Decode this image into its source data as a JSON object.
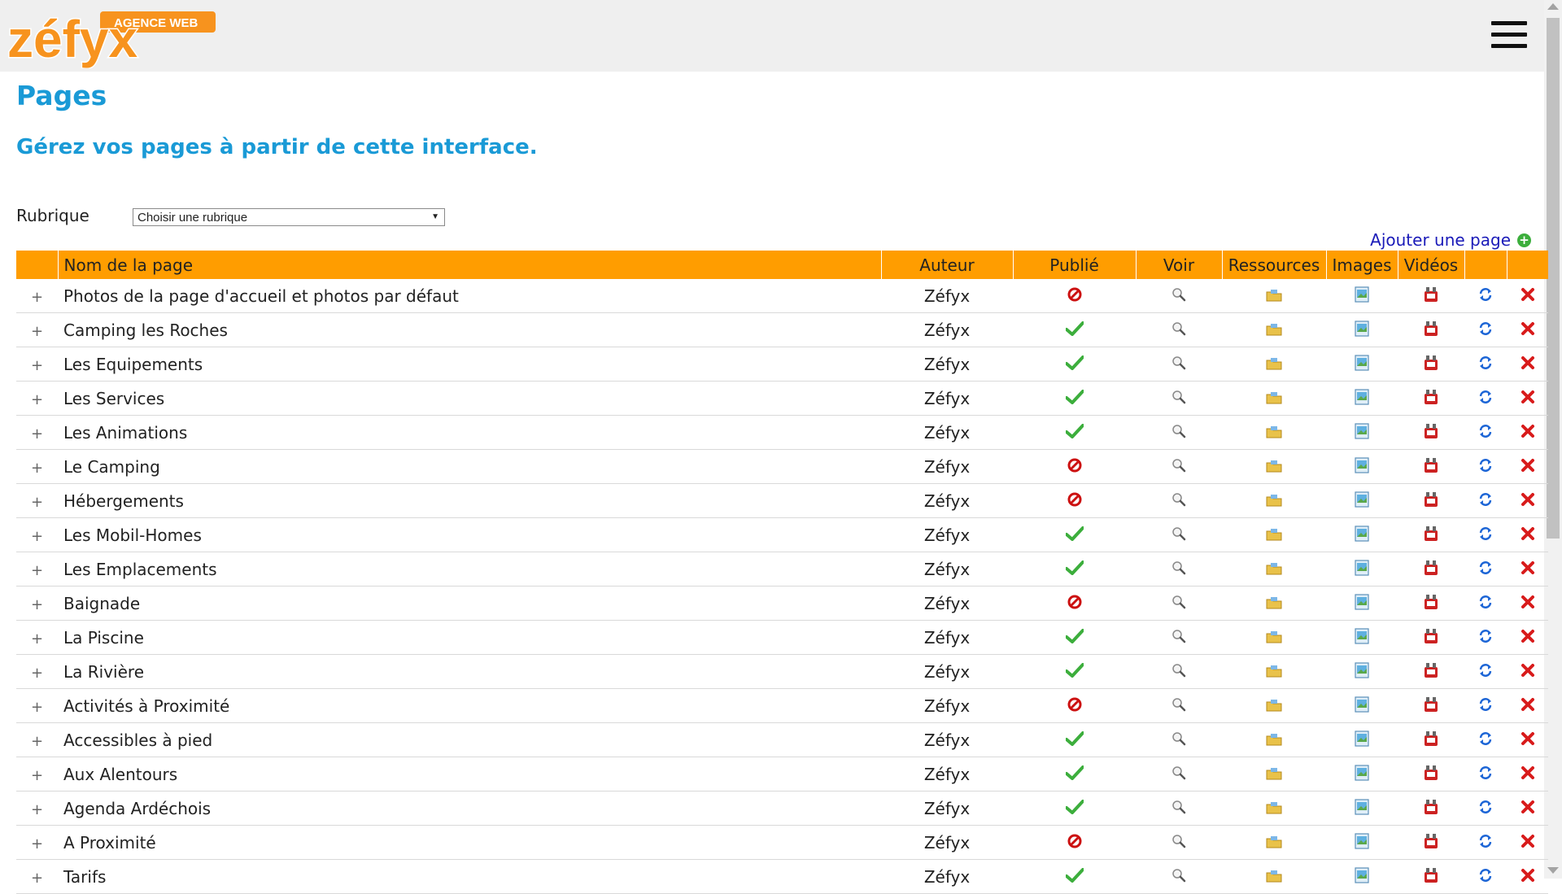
{
  "header": {
    "logo_text": "zéfyx",
    "logo_tagline": "AGENCE WEB",
    "menu_icon": "hamburger-menu-icon"
  },
  "page": {
    "title": "Pages",
    "subtitle": "Gérez vos pages à partir de cette interface."
  },
  "filter": {
    "label": "Rubrique",
    "select_value": "Choisir une rubrique"
  },
  "actions": {
    "add_page_label": "Ajouter une page",
    "add_icon": "plus-circle-icon"
  },
  "table": {
    "columns": [
      "",
      "Nom de la page",
      "Auteur",
      "Publié",
      "Voir",
      "Ressources",
      "Images",
      "Vidéos",
      "",
      ""
    ],
    "expand_symbol": "+",
    "rows": [
      {
        "name": "Photos de la page d'accueil et photos par défaut",
        "author": "Zéfyx",
        "published": false
      },
      {
        "name": "Camping les Roches",
        "author": "Zéfyx",
        "published": true
      },
      {
        "name": "Les Equipements",
        "author": "Zéfyx",
        "published": true
      },
      {
        "name": "Les Services",
        "author": "Zéfyx",
        "published": true
      },
      {
        "name": "Les Animations",
        "author": "Zéfyx",
        "published": true
      },
      {
        "name": "Le Camping",
        "author": "Zéfyx",
        "published": false
      },
      {
        "name": "Hébergements",
        "author": "Zéfyx",
        "published": false
      },
      {
        "name": "Les Mobil-Homes",
        "author": "Zéfyx",
        "published": true
      },
      {
        "name": "Les Emplacements",
        "author": "Zéfyx",
        "published": true
      },
      {
        "name": "Baignade",
        "author": "Zéfyx",
        "published": false
      },
      {
        "name": "La Piscine",
        "author": "Zéfyx",
        "published": true
      },
      {
        "name": "La Rivière",
        "author": "Zéfyx",
        "published": true
      },
      {
        "name": "Activités à Proximité",
        "author": "Zéfyx",
        "published": false
      },
      {
        "name": "Accessibles à pied",
        "author": "Zéfyx",
        "published": true
      },
      {
        "name": "Aux Alentours",
        "author": "Zéfyx",
        "published": true
      },
      {
        "name": "Agenda Ardéchois",
        "author": "Zéfyx",
        "published": true
      },
      {
        "name": "A Proximité",
        "author": "Zéfyx",
        "published": false
      },
      {
        "name": "Tarifs",
        "author": "Zéfyx",
        "published": true
      }
    ]
  },
  "colors": {
    "accent_blue": "#1a9ad6",
    "header_orange": "#ff9d00",
    "link_blue": "#1a1ab8",
    "published_green": "#3cae3c",
    "unpublished_red": "#cc1111",
    "topbar_gray": "#efefef"
  }
}
